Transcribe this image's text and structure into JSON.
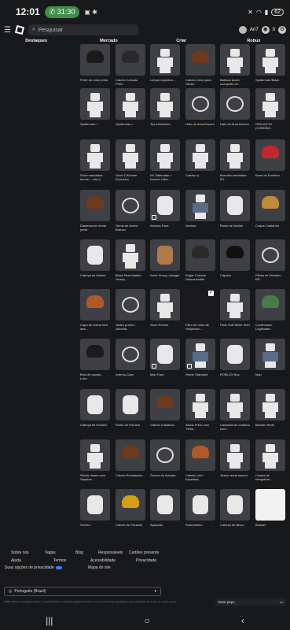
{
  "statusbar": {
    "time": "12:01",
    "call": "31:30",
    "battery": "62",
    "icons": "▣ ✱"
  },
  "topbar": {
    "search_placeholder": "Pesquisar",
    "user": "Ari7",
    "robux_count": "0"
  },
  "tabs": [
    "Destaques",
    "Mercado",
    "Criar",
    "Robux"
  ],
  "items": [
    [
      "Porte do rosto preto",
      "Cabelo Curtado Preto",
      "Limpar espinhos...",
      "Cabelo Lindo para Gente...",
      "Batman boxer cueupinto cri...",
      "Spiderman Black"
    ],
    [
      "Spiderman •",
      "Spiderman •",
      "Tey Animation...",
      "Halo de Aura Escura",
      "Halo de Aura Branco",
      "ORA DD RJ (CORDÃO..."
    ],
    [
      "Short mandrake - kenner - cria rj",
      "Short C/Kenner Exclusivo",
      "Kit Tottenham + Kenner Ultra...",
      "Camiso rj",
      "Brocoito mandrake RJ...",
      "Boné do Encierro"
    ],
    [
      "Diadema de renda preta",
      "Gema de Anime Branco",
      "Woman Face",
      "Woman",
      "Rosto de Mulher",
      "Coque Castanho"
    ],
    [
      "Cabeça de Mulher",
      "Black Real Madrid Jersey...",
      "Sorrir Smug | Naugut",
      "Edgar Cortado Desconectido",
      "Capado",
      "Pilhas de Dinheiro BR..."
    ],
    [
      "Capa de chima fora das...",
      "Slides pretos / chinelas",
      "Short Kenner",
      "Filtro de rosto de Hollywoon...",
      "Plain Soft White Shirt",
      "Confirmado, Legitimate..."
    ],
    [
      "Bolo de cavalo - Loiro",
      "Aranha-Cata",
      "Man Face",
      "Stevie Standard",
      "ROBLOX Boy",
      "Man"
    ],
    [
      "Cabeça de Homem",
      "Rosto de Homem",
      "Cabelo Castanho",
      "Jeans Preto com Tênis...",
      "Camisola do Guitarra com...",
      "Blusão Verde"
    ],
    [
      "Shorts Jeans com Sapatos...",
      "Cabelo Encantador...",
      "Óculos de Aviador...",
      "Cabelo Loiro Espetado",
      "Jeans verde escuro",
      "Cestas de mergulhar..."
    ],
    [
      "Sorriso",
      "Cabelo de Parasito",
      "Apanado",
      "Redondinho",
      "Cabeça de Bloco",
      "Blusser"
    ]
  ],
  "footer": {
    "links": [
      "Sobre nós",
      "Vagas",
      "Blog",
      "Responsáveis",
      "Cartões presente",
      "Ajuda",
      "Termos",
      "Acessibilidade",
      "Privacidade",
      "Suas opções de privacidade",
      "Mapa do site"
    ],
    "language": "Português (Brasil)",
    "copyright": "©2025 Roblox Corporation. Roblox, o logotipo Roblox e Powering Imagination estão entre nossas marcas registradas e não registradas nos EUA e em outros países.",
    "chat": "Bate-papo"
  },
  "colors": {
    "background": "#18191b",
    "tile": "#3f4046",
    "accent": "#3c7bff"
  }
}
